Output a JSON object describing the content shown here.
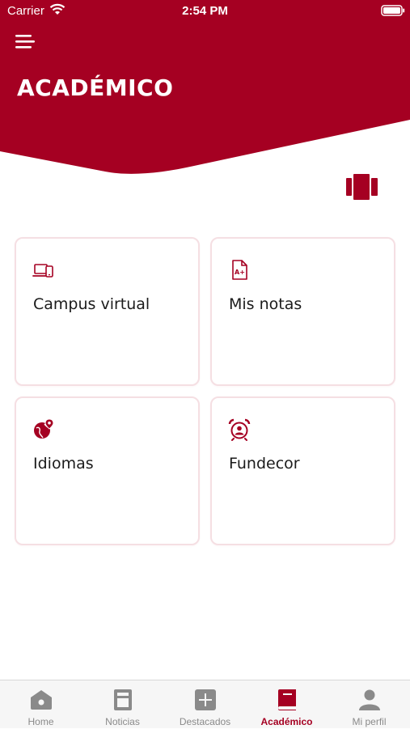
{
  "colors": {
    "brand": "#a50022",
    "card_border": "#f5dfe3",
    "tab_inactive": "#8a8a8a",
    "tab_bar_bg": "#f6f6f6"
  },
  "status_bar": {
    "carrier": "Carrier",
    "time": "2:54 PM"
  },
  "header": {
    "title": "ACADÉMICO",
    "menu_icon": "hamburger-menu-icon",
    "layout_icon": "carousel-layout-icon"
  },
  "cards": [
    {
      "label": "Campus virtual",
      "icon": "laptop-devices-icon"
    },
    {
      "label": "Mis notas",
      "icon": "grade-document-icon"
    },
    {
      "label": "Idiomas",
      "icon": "globe-location-icon"
    },
    {
      "label": "Fundecor",
      "icon": "alarm-clock-person-icon"
    }
  ],
  "tabs": [
    {
      "label": "Home",
      "icon": "home-icon",
      "active": false
    },
    {
      "label": "Noticias",
      "icon": "news-icon",
      "active": false
    },
    {
      "label": "Destacados",
      "icon": "plus-square-icon",
      "active": false
    },
    {
      "label": "Académico",
      "icon": "book-icon",
      "active": true
    },
    {
      "label": "Mi perfil",
      "icon": "person-icon",
      "active": false
    }
  ]
}
